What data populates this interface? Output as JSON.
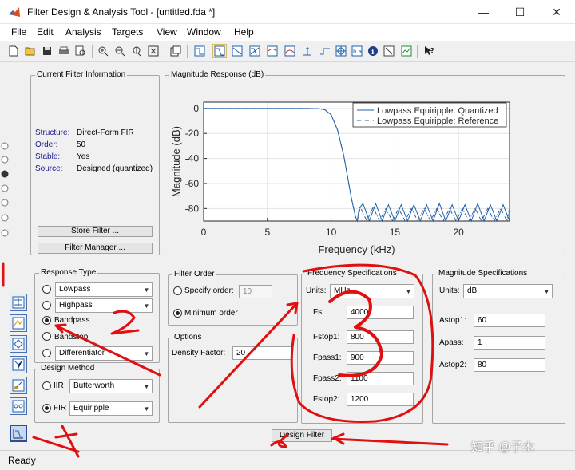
{
  "window": {
    "title": "Filter Design & Analysis Tool - [untitled.fda *]",
    "minimize": "—",
    "maximize": "☐",
    "close": "✕"
  },
  "menu": [
    {
      "label": "File"
    },
    {
      "label": "Edit"
    },
    {
      "label": "Analysis"
    },
    {
      "label": "Targets"
    },
    {
      "label": "View"
    },
    {
      "label": "Window"
    },
    {
      "label": "Help"
    }
  ],
  "current_filter": {
    "title": "Current Filter Information",
    "rows": [
      {
        "key": "Structure:",
        "value": "Direct-Form FIR"
      },
      {
        "key": "Order:",
        "value": "50"
      },
      {
        "key": "Stable:",
        "value": "Yes"
      },
      {
        "key": "Source:",
        "value": "Designed (quantized)"
      }
    ],
    "store_button": "Store Filter ...",
    "manager_button": "Filter Manager ..."
  },
  "plot": {
    "frame_title": "Magnitude Response (dB)"
  },
  "chart_data": {
    "type": "line",
    "xlabel": "Frequency (kHz)",
    "ylabel": "Magnitude (dB)",
    "xlim": [
      0,
      24
    ],
    "ylim": [
      -90,
      5
    ],
    "xticks": [
      "0",
      "5",
      "10",
      "15",
      "20"
    ],
    "xtick_values": [
      0,
      5,
      10,
      15,
      20
    ],
    "yticks": [
      "0",
      "-20",
      "-40",
      "-60",
      "-80"
    ],
    "ytick_values": [
      0,
      -20,
      -40,
      -60,
      -80
    ],
    "legend_position": "top-right",
    "series": [
      {
        "name": "Lowpass Equiripple: Quantized",
        "style": "solid",
        "color": "#1f5fa8",
        "x": [
          0,
          1,
          2,
          3,
          4,
          5,
          6,
          7,
          8,
          9,
          9.5,
          10,
          10.5,
          11,
          11.3,
          11.6,
          11.9,
          12.05,
          12.2,
          12.5,
          13,
          13.5,
          14,
          14.5,
          15,
          15.5,
          16,
          16.5,
          17,
          17.5,
          18,
          18.5,
          19,
          19.5,
          20,
          20.5,
          21,
          21.5,
          22,
          22.5,
          23,
          23.5,
          24
        ],
        "y": [
          0,
          0,
          0,
          0,
          0,
          0,
          0,
          0,
          0,
          -0.2,
          -1,
          -5,
          -17,
          -38,
          -55,
          -72,
          -86,
          -90,
          -80,
          -76,
          -90,
          -76,
          -90,
          -77,
          -90,
          -77,
          -90,
          -77,
          -90,
          -77,
          -90,
          -76,
          -90,
          -77,
          -90,
          -77,
          -90,
          -76,
          -90,
          -77,
          -90,
          -77,
          -90
        ]
      },
      {
        "name": "Lowpass Equiripple: Reference",
        "style": "dashdot",
        "color": "#1f5fa8",
        "x": [
          0,
          1,
          2,
          3,
          4,
          5,
          6,
          7,
          8,
          9,
          9.5,
          10,
          10.5,
          11,
          11.3,
          11.6,
          11.9,
          12.05,
          12.3,
          12.8,
          13.3,
          13.8,
          14.3,
          14.8,
          15.3,
          15.8,
          16.3,
          16.8,
          17.3,
          17.8,
          18.3,
          18.8,
          19.3,
          19.8,
          20.3,
          20.8,
          21.3,
          21.8,
          22.3,
          22.8,
          23.3,
          23.8,
          24
        ],
        "y": [
          0,
          0,
          0,
          0,
          0,
          0,
          0,
          0,
          0,
          -0.2,
          -1,
          -5,
          -17,
          -38,
          -55,
          -72,
          -86,
          -90,
          -79,
          -90,
          -79,
          -90,
          -80,
          -90,
          -80,
          -90,
          -80,
          -90,
          -80,
          -90,
          -80,
          -90,
          -80,
          -90,
          -80,
          -90,
          -80,
          -90,
          -80,
          -90,
          -80,
          -90,
          -80
        ]
      }
    ]
  },
  "response_type": {
    "title": "Response Type",
    "options": [
      {
        "label": "Lowpass",
        "selected": false
      },
      {
        "label": "Highpass",
        "selected": false
      },
      {
        "label": "Bandpass",
        "selected": true
      },
      {
        "label": "Bandstop",
        "selected": false
      },
      {
        "label": "Differentiator",
        "selected": false
      }
    ]
  },
  "design_method": {
    "title": "Design Method",
    "iir_label": "IIR",
    "iir_value": "Butterworth",
    "fir_label": "FIR",
    "fir_value": "Equiripple"
  },
  "filter_order": {
    "title": "Filter Order",
    "specify_label": "Specify order:",
    "specify_value": "10",
    "minimum_label": "Minimum order"
  },
  "options": {
    "title": "Options",
    "density_label": "Density Factor:",
    "density_value": "20"
  },
  "freq_specs": {
    "title": "Frequency Specifications",
    "units_label": "Units:",
    "units_value": "MHz",
    "fields": [
      {
        "label": "Fs:",
        "value": "4000"
      },
      {
        "label": "Fstop1:",
        "value": "800"
      },
      {
        "label": "Fpass1:",
        "value": "900"
      },
      {
        "label": "Fpass2:",
        "value": "1100"
      },
      {
        "label": "Fstop2:",
        "value": "1200"
      }
    ]
  },
  "mag_specs": {
    "title": "Magnitude Specifications",
    "units_label": "Units:",
    "units_value": "dB",
    "fields": [
      {
        "label": "Astop1:",
        "value": "60"
      },
      {
        "label": "Apass:",
        "value": "1"
      },
      {
        "label": "Astop2:",
        "value": "80"
      }
    ]
  },
  "design_button": "Design Filter",
  "status": "Ready",
  "watermark": "知乎 @子木",
  "annotation_color": "#e01010"
}
